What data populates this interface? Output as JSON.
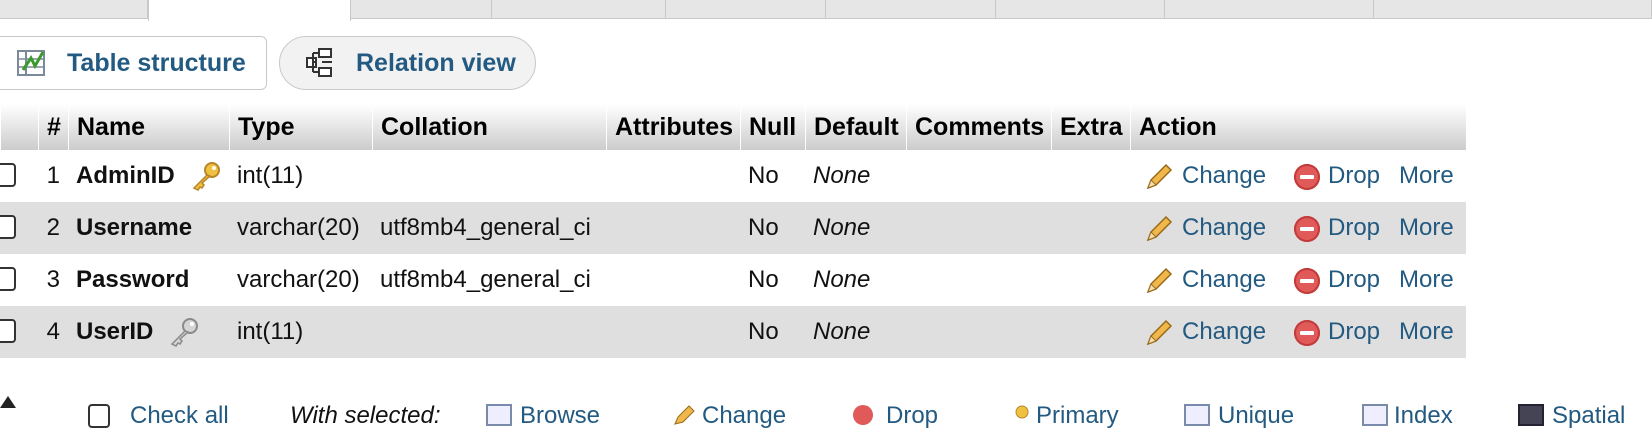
{
  "subnav": {
    "table_structure": "Table structure",
    "relation_view": "Relation view"
  },
  "table": {
    "headers": [
      "#",
      "Name",
      "Type",
      "Collation",
      "Attributes",
      "Null",
      "Default",
      "Comments",
      "Extra",
      "Action"
    ],
    "rows": [
      {
        "num": "1",
        "name": "AdminID",
        "type": "int(11)",
        "collation": "",
        "null": "No",
        "default": "None",
        "key": "primary-key-icon"
      },
      {
        "num": "2",
        "name": "Username",
        "type": "varchar(20)",
        "collation": "utf8mb4_general_ci",
        "null": "No",
        "default": "None",
        "key": ""
      },
      {
        "num": "3",
        "name": "Password",
        "type": "varchar(20)",
        "collation": "utf8mb4_general_ci",
        "null": "No",
        "default": "None",
        "key": ""
      },
      {
        "num": "4",
        "name": "UserID",
        "type": "int(11)",
        "collation": "",
        "null": "No",
        "default": "None",
        "key": "index-key-icon"
      }
    ],
    "actions": {
      "change": "Change",
      "drop": "Drop",
      "more": "More"
    }
  },
  "bottom": {
    "check_all": "Check all",
    "with_selected": "With selected:",
    "items": [
      "Browse",
      "Change",
      "Drop",
      "Primary",
      "Unique",
      "Index",
      "Spatial"
    ]
  },
  "colors": {
    "link": "#235a81",
    "row_alt": "#dfdfdf",
    "drop_red": "#e15a5a",
    "key_gold": "#e8b33a"
  }
}
